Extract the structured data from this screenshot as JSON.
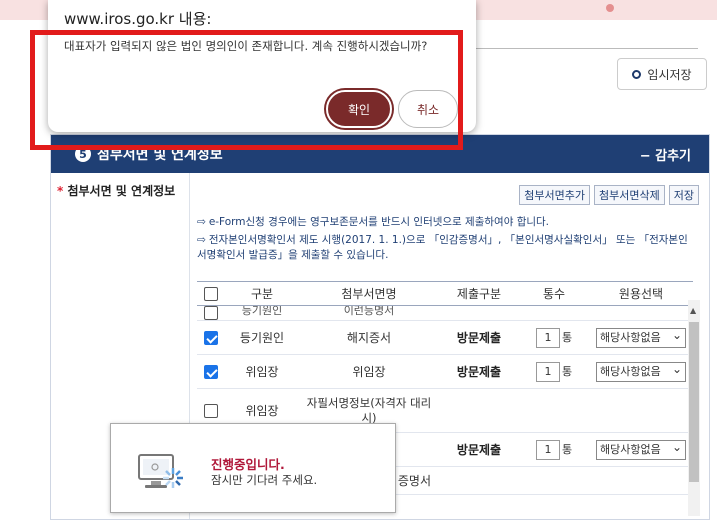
{
  "dialog": {
    "site": "www.iros.go.kr 내용:",
    "message": "대표자가 입력되지 않은 법인 명의인이 존재합니다. 계속 진행하시겠습니까?",
    "ok_label": "확인",
    "cancel_label": "취소"
  },
  "toolbar": {
    "save_temp_label": "임시저장"
  },
  "section": {
    "number": "5",
    "title": "첨부서면 및 연계정보",
    "collapse_label": "− 감추기",
    "left_label": "첨부서면 및 연계정보",
    "buttons": [
      "첨부서면추가",
      "첨부서면삭제",
      "저장"
    ],
    "notices": [
      "e-Form신청 경우에는 영구보존문서를 반드시 인터넷으로 제출하여야 합니다.",
      "전자본인서명확인서 제도 시행(2017. 1. 1.)으로 「인감증명서」, 「본인서명사실확인서」 또는 「전자본인서명확인서 발급증」을 제출할 수 있습니다."
    ]
  },
  "table": {
    "headers": [
      "구분",
      "첨부서면명",
      "제출구분",
      "통수",
      "원용선택"
    ],
    "partial_row": {
      "gubun": "등기원인",
      "name": "이런등명서"
    },
    "rows": [
      {
        "checked": true,
        "gubun": "등기원인",
        "name": "해지증서",
        "submit": "방문제출",
        "count": "1",
        "unit": "통",
        "select": "해당사항없음"
      },
      {
        "checked": true,
        "gubun": "위임장",
        "name": "위임장",
        "submit": "방문제출",
        "count": "1",
        "unit": "통",
        "select": "해당사항없음"
      },
      {
        "checked": false,
        "gubun": "위임장",
        "name": "자필서명정보(자격자 대리 시)",
        "submit": "",
        "count": "",
        "unit": "",
        "select": ""
      },
      {
        "checked": false,
        "gubun": "",
        "name": "",
        "submit": "방문제출",
        "count": "1",
        "unit": "통",
        "select": "해당사항없음"
      },
      {
        "checked": false,
        "gubun": "",
        "name": "증명서",
        "submit": "",
        "count": "",
        "unit": "",
        "select": ""
      }
    ]
  },
  "progress": {
    "title": "진행중입니다.",
    "subtitle": "잠시만 기다려 주세요."
  }
}
